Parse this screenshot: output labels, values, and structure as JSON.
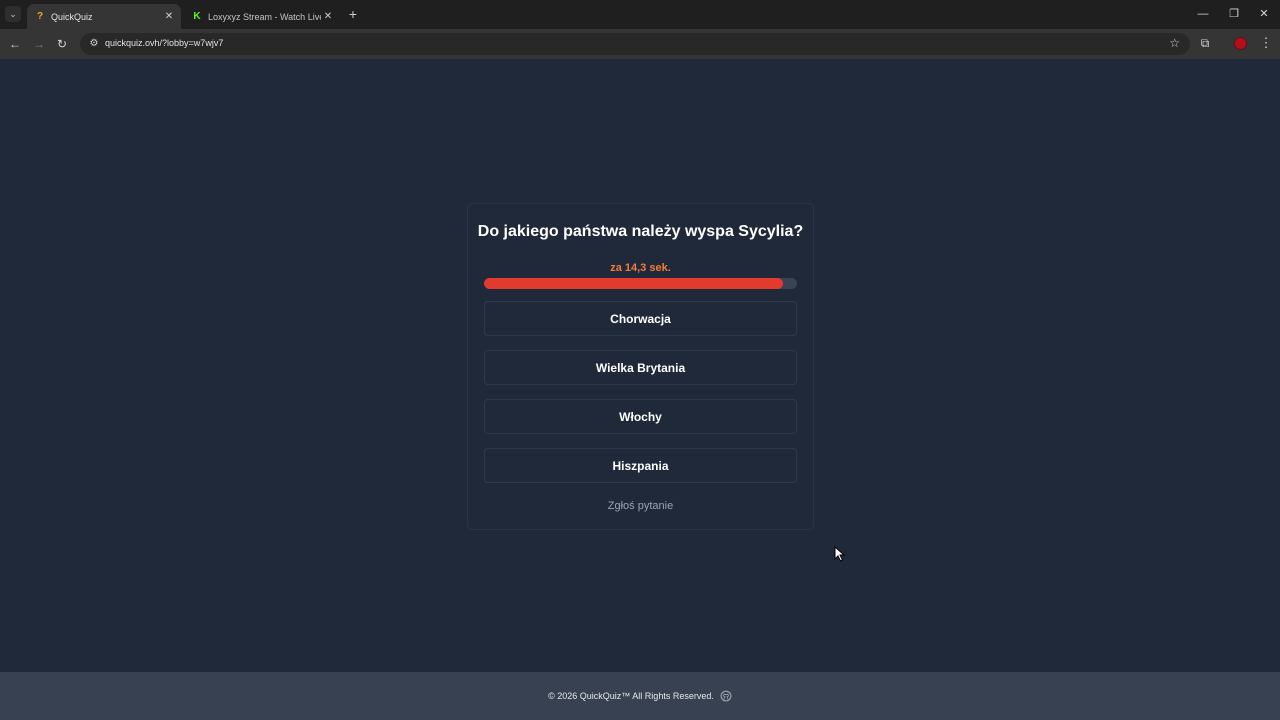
{
  "browser": {
    "tabs": [
      {
        "favicon_glyph": "?",
        "title": "QuickQuiz",
        "close": "✕"
      },
      {
        "favicon_glyph": "K",
        "title": "Loxyxyz Stream - Watch Live on",
        "close": "✕"
      }
    ],
    "tab_menu_glyph": "⌄",
    "new_tab_glyph": "+",
    "window_controls": {
      "minimize": "—",
      "restore": "❐",
      "close": "✕"
    },
    "nav": {
      "back": "←",
      "forward": "→",
      "reload": "↻"
    },
    "site_info_glyph": "⚙",
    "url": "quickquiz.ovh/?lobby=w7wjv7",
    "bookmark_glyph": "☆",
    "extensions_glyph": "⧉",
    "menu_glyph": "⋮"
  },
  "quiz": {
    "question": "Do jakiego państwa należy wyspa Sycylia?",
    "timer_text": "za 14,3 sek.",
    "time_remaining_fraction": 0.955,
    "answers": [
      "Chorwacja",
      "Wielka Brytania",
      "Włochy",
      "Hiszpania"
    ],
    "report_label": "Zgłoś pytanie"
  },
  "footer": {
    "copyright": "© 2026  QuickQuiz™ All Rights Reserved."
  },
  "colors": {
    "page_background": "#202939",
    "footer_background": "#374151",
    "timer_accent": "#f47b3c",
    "progress_fill": "#e23b2e",
    "progress_track": "#3a4354"
  }
}
